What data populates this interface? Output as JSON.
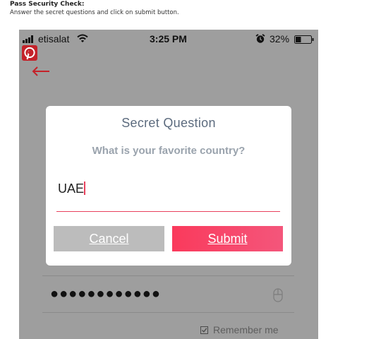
{
  "header": {
    "title": "Pass Security Check:",
    "instructions": "Answer the secret questions and click on submit button."
  },
  "status_bar": {
    "carrier": "etisalat",
    "time": "3:25 PM",
    "battery": "32%"
  },
  "background_form": {
    "password_mask": "●●●●●●●●●●●●",
    "remember_label": "Remember me",
    "remember_checked": true
  },
  "dialog": {
    "title": "Secret Question",
    "question": "What is your favorite country?",
    "answer": "UAE",
    "cancel_label": "Cancel",
    "submit_label": "Submit"
  },
  "colors": {
    "accent": "#f53d5f",
    "overlay": "#9e9e9e",
    "title_text": "#5c6b7e",
    "back_arrow": "#c4222a"
  }
}
